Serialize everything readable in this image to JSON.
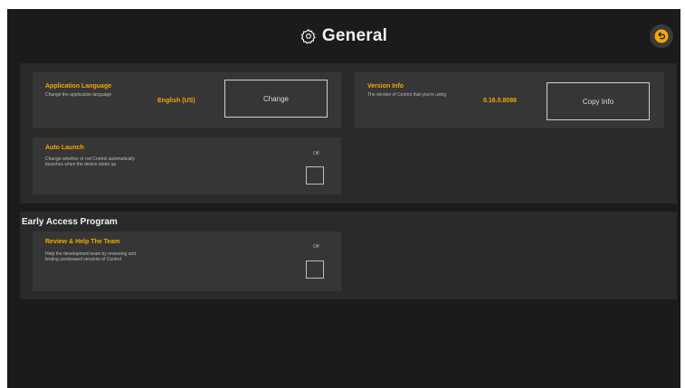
{
  "header": {
    "title": "General",
    "icons": {
      "gear": "gear-icon",
      "back": "back-arrow-icon"
    },
    "accent": "#f2a900"
  },
  "general": {
    "language": {
      "title": "Application Language",
      "description": "Change the application language",
      "value": "English (US)",
      "button": "Change"
    },
    "version": {
      "title": "Version Info",
      "description": "The version of Control that you're using",
      "value": "0.16.0.8086",
      "button": "Copy Info"
    },
    "auto_launch": {
      "title": "Auto Launch",
      "description_line1": "Change whether or not Control automatically",
      "description_line2": "launches when the device starts up",
      "state": "Off"
    }
  },
  "eap": {
    "heading": "Early Access Program",
    "review": {
      "title": "Review & Help The Team",
      "description_line1": "Help the development team by reviewing and",
      "description_line2": "testing unreleased versions of Control",
      "state": "Off"
    }
  }
}
